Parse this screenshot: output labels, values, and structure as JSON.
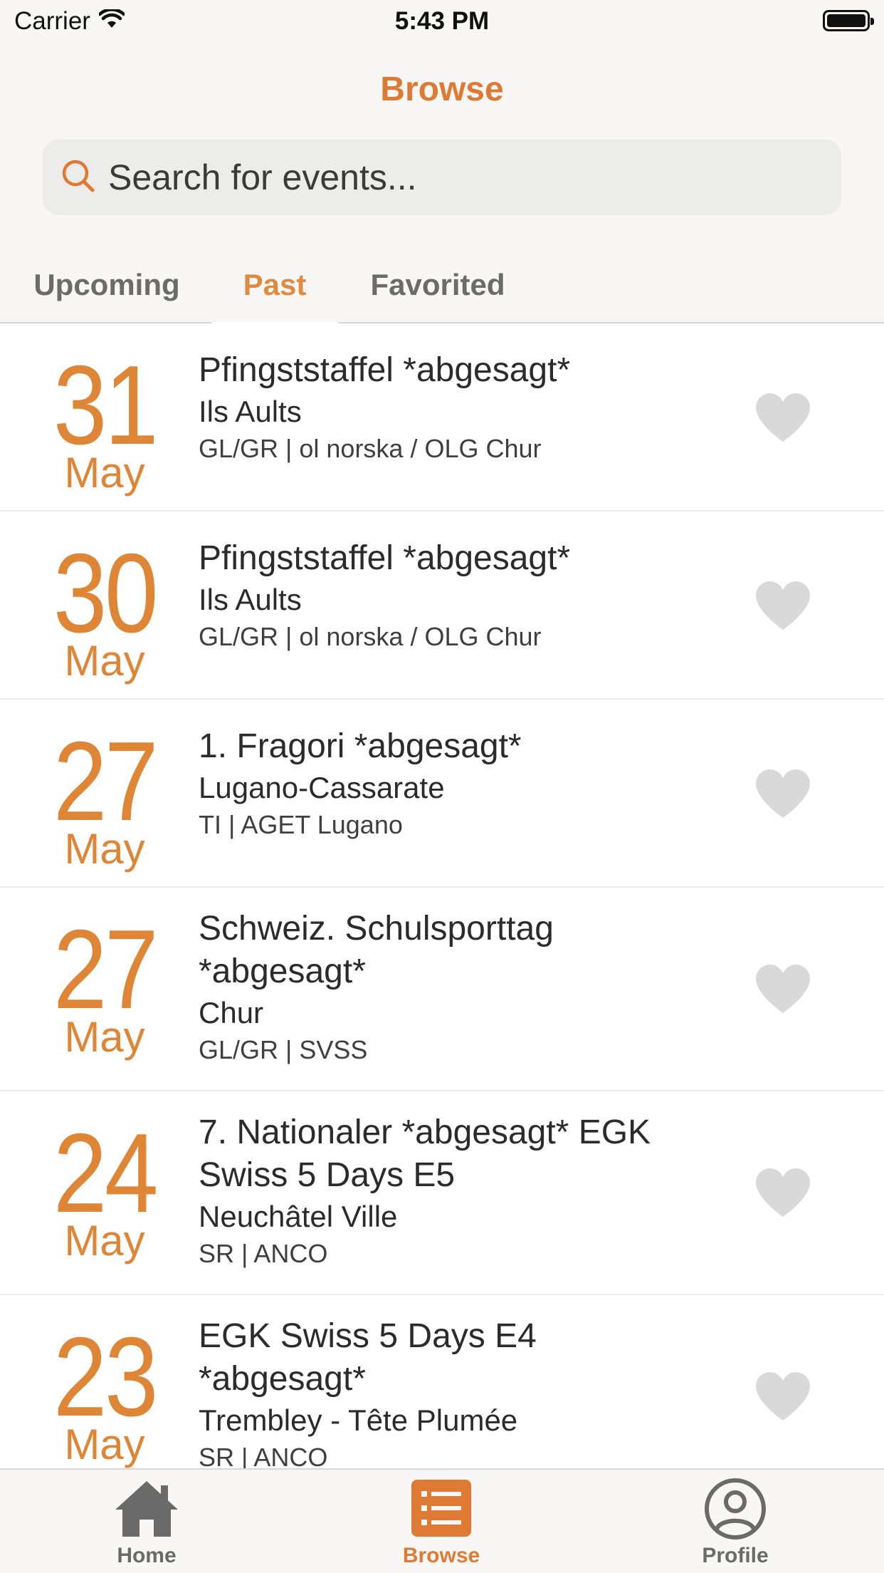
{
  "status": {
    "carrier": "Carrier",
    "time": "5:43 PM"
  },
  "nav": {
    "title": "Browse"
  },
  "search": {
    "placeholder": "Search for events..."
  },
  "tabs": [
    {
      "label": "Upcoming"
    },
    {
      "label": "Past"
    },
    {
      "label": "Favorited"
    }
  ],
  "events": [
    {
      "day": "31",
      "month": "May",
      "title": "Pfingststaffel *abgesagt*",
      "location": "Ils Aults",
      "club": "GL/GR | ol norska / OLG Chur"
    },
    {
      "day": "30",
      "month": "May",
      "title": "Pfingststaffel *abgesagt*",
      "location": "Ils Aults",
      "club": "GL/GR | ol norska / OLG Chur"
    },
    {
      "day": "27",
      "month": "May",
      "title": "1. Fragori *abgesagt*",
      "location": "Lugano-Cassarate",
      "club": "TI | AGET Lugano"
    },
    {
      "day": "27",
      "month": "May",
      "title": "Schweiz. Schulsporttag *abgesagt*",
      "location": "Chur",
      "club": "GL/GR | SVSS"
    },
    {
      "day": "24",
      "month": "May",
      "title": "7. Nationaler *abgesagt* EGK Swiss 5 Days E5",
      "location": "Neuchâtel Ville",
      "club": "SR | ANCO"
    },
    {
      "day": "23",
      "month": "May",
      "title": "EGK Swiss 5 Days E4 *abgesagt*",
      "location": "Trembley - Tête Plumée",
      "club": "SR | ANCO"
    }
  ],
  "tab_bar": [
    {
      "label": "Home",
      "icon": "home-icon"
    },
    {
      "label": "Browse",
      "icon": "list-icon"
    },
    {
      "label": "Profile",
      "icon": "profile-icon"
    }
  ],
  "colors": {
    "accent": "#de7a33",
    "date": "#de8536",
    "heart": "#d9d9d9"
  }
}
